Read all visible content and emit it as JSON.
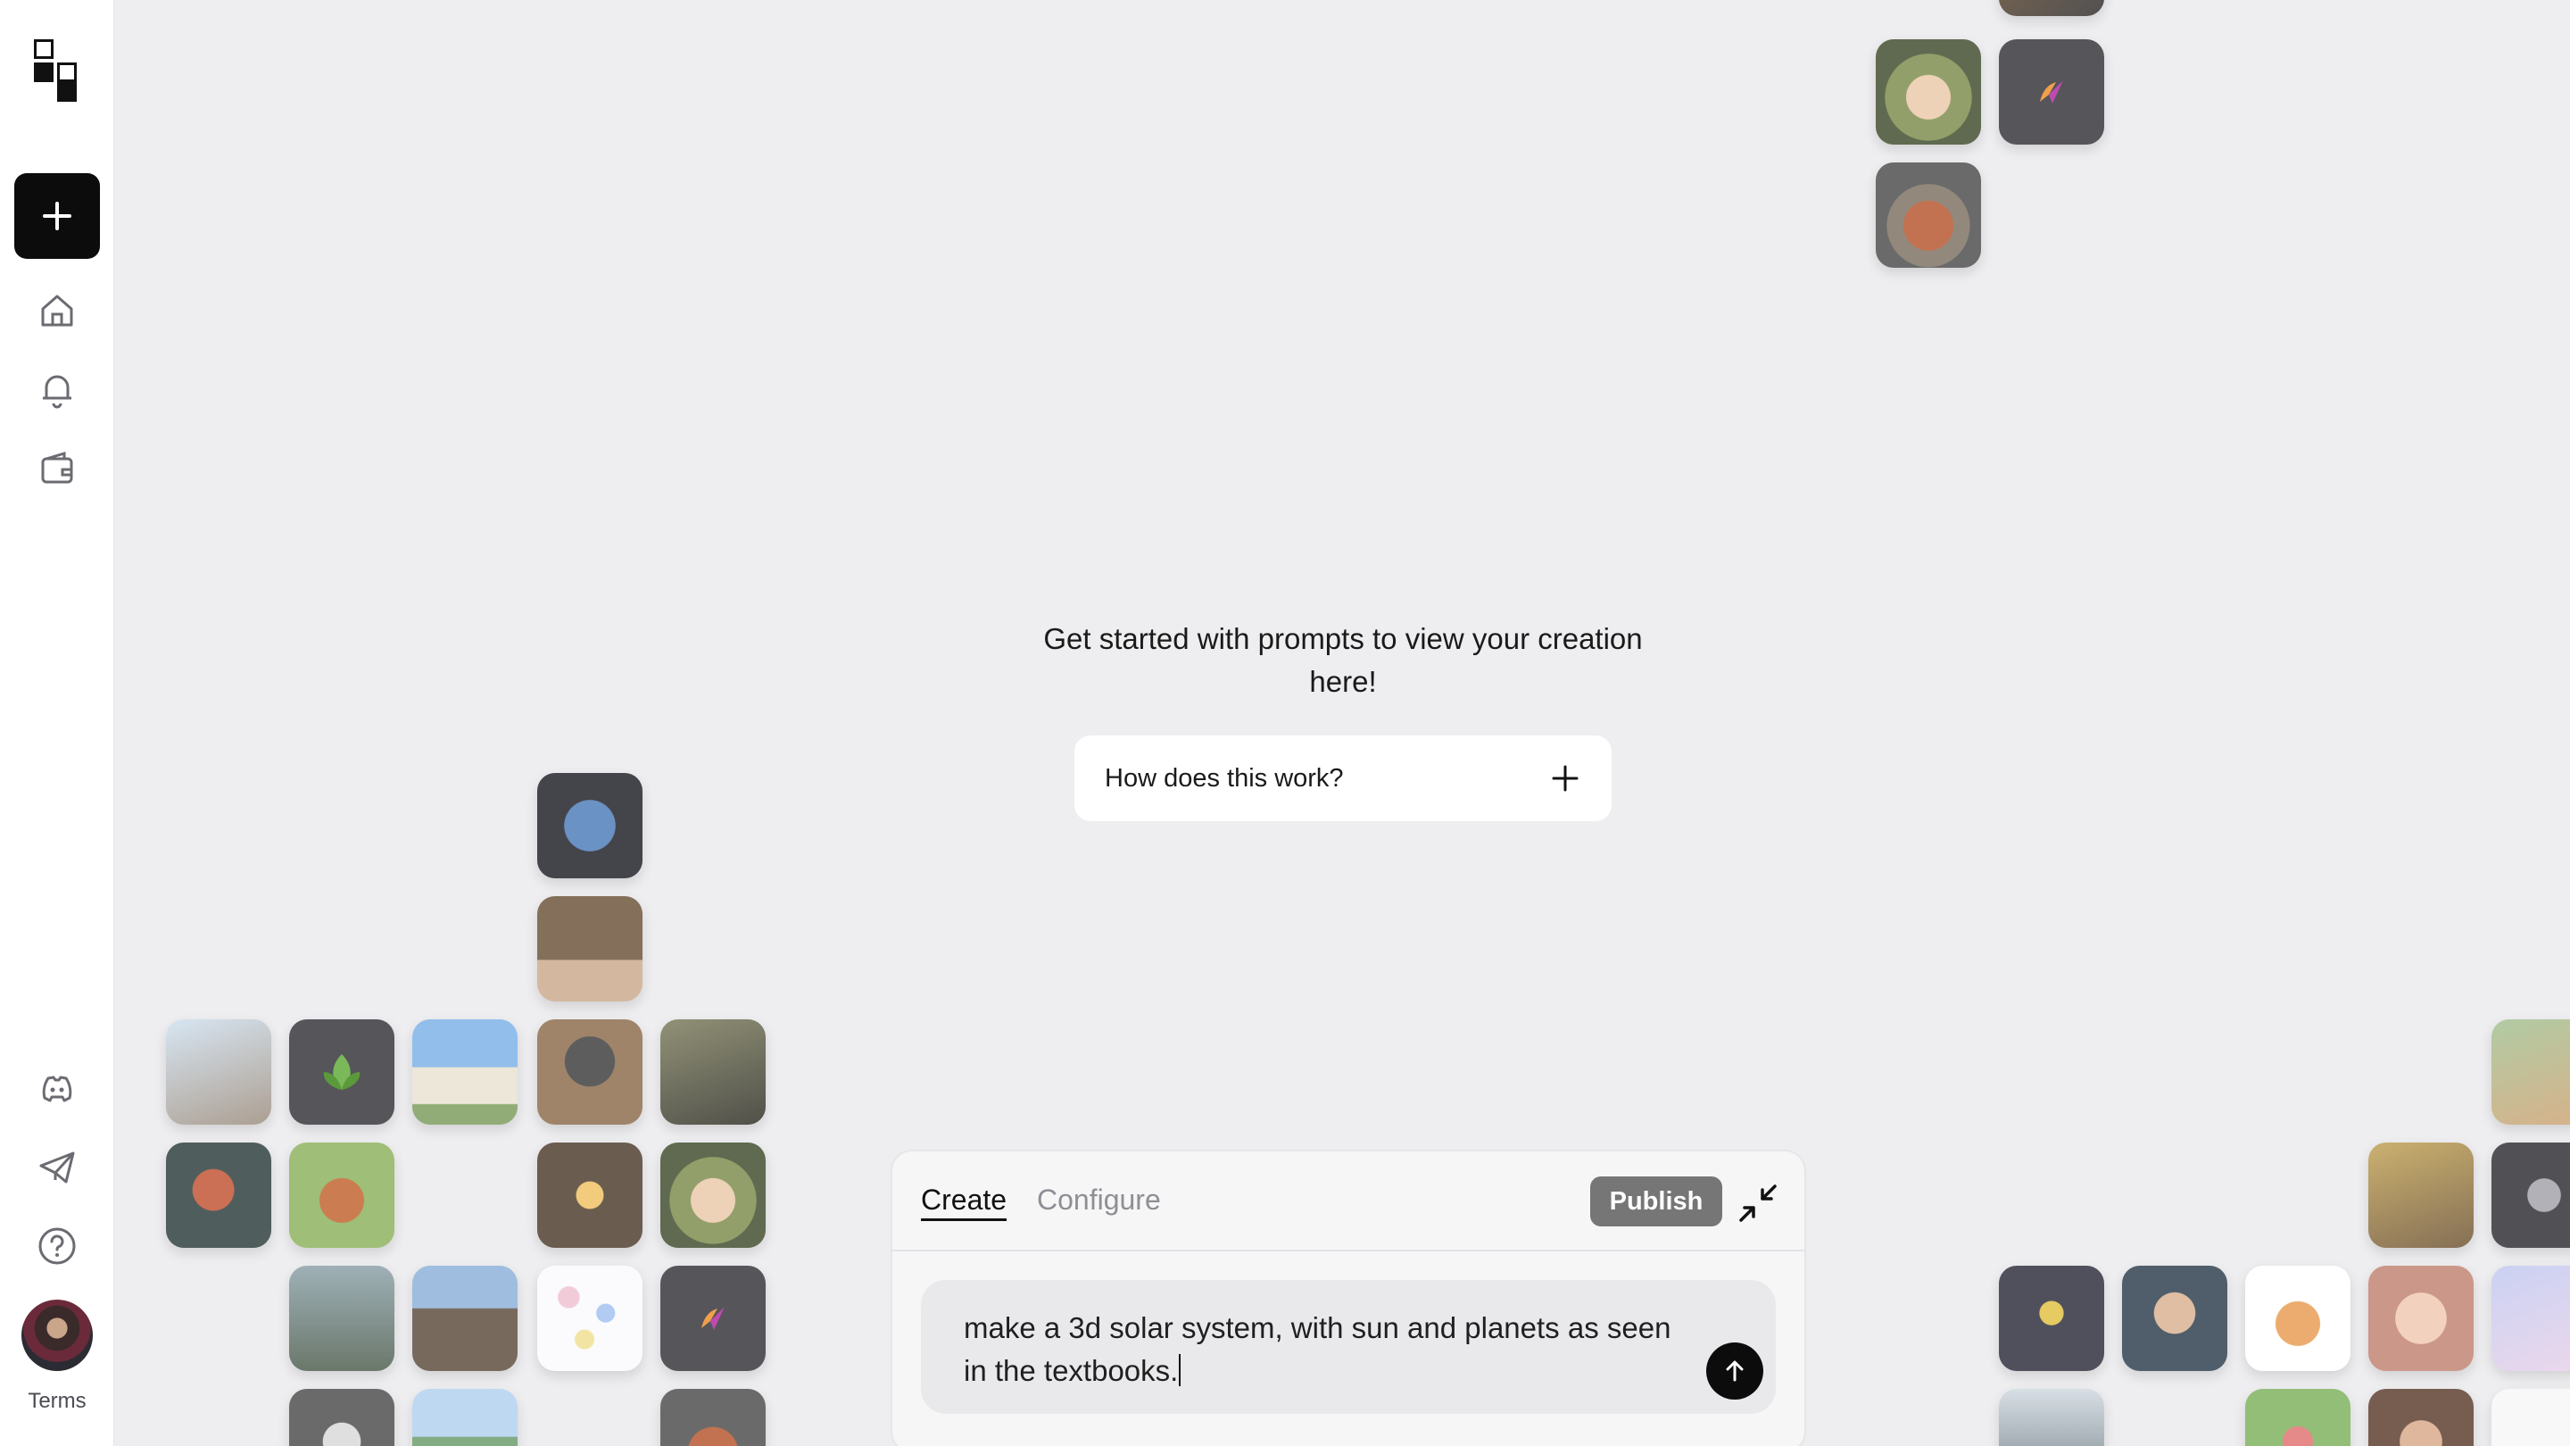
{
  "sidebar": {
    "nav": [
      "home-icon",
      "bell-icon",
      "wallet-icon"
    ],
    "bottom": [
      "discord-icon",
      "telegram-icon",
      "help-icon"
    ],
    "terms_label": "Terms"
  },
  "main": {
    "empty_message": "Get started with prompts to view your creation here!",
    "how_label": "How does this work?"
  },
  "panel": {
    "tabs": [
      "Create",
      "Configure"
    ],
    "active_tab": "Create",
    "publish_label": "Publish",
    "prompt_text": "make a 3d solar system, with sun and planets as seen in the textbooks."
  },
  "colors": {
    "accent": "#0c0c0c",
    "background": "#eeeef0",
    "publish": "#767676"
  }
}
